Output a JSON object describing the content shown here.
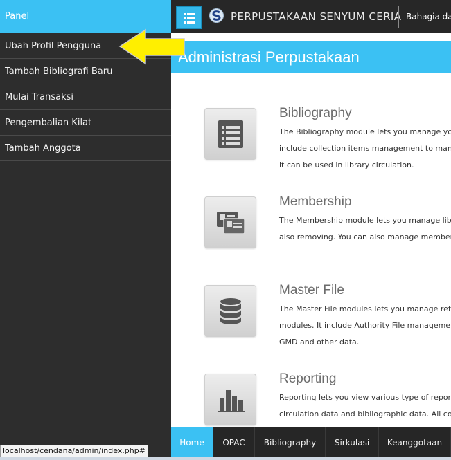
{
  "sidebar": {
    "header": "Panel",
    "items": [
      {
        "label": "Ubah Profil Pengguna"
      },
      {
        "label": "Tambah Bibliografi Baru"
      },
      {
        "label": "Mulai Transaksi"
      },
      {
        "label": "Pengembalian Kilat"
      },
      {
        "label": "Tambah Anggota"
      }
    ]
  },
  "topbar": {
    "menu_icon": "hamburger-list-icon",
    "logo_icon": "senayan-logo-icon",
    "brand": "PERPUSTAKAAN SENYUM CERIA",
    "greeting": "Bahagia dari"
  },
  "page": {
    "title": "Administrasi Perpustakaan"
  },
  "modules": [
    {
      "title": "Bibliography",
      "icon": "list-document-icon",
      "lines": [
        "The Bibliography module lets you manage your library bibliographical data. It",
        "include collection items management to manage a copies of your library so",
        "it can be used in library circulation."
      ]
    },
    {
      "title": "Membership",
      "icon": "member-cards-icon",
      "lines": [
        "The Membership module lets you manage library members such adding, updating and",
        "also removing. You can also manage membership type in this module."
      ]
    },
    {
      "title": "Master File",
      "icon": "database-icon",
      "lines": [
        "The Master File modules lets you manage referential data that will be used by another",
        "modules. It include Authority File management such as Authority, Subject/Topic List,",
        "GMD and other data."
      ]
    },
    {
      "title": "Reporting",
      "icon": "bar-chart-icon",
      "lines": [
        "Reporting lets you view various type of reports regardings membership data,",
        "circulation data and bibliographic data. All compiled on-the-fly from current library"
      ]
    }
  ],
  "bottomnav": {
    "items": [
      {
        "label": "Home",
        "active": true
      },
      {
        "label": "OPAC"
      },
      {
        "label": "Bibliography"
      },
      {
        "label": "Sirkulasi"
      },
      {
        "label": "Keanggotaan"
      }
    ]
  },
  "status": {
    "url": "localhost/cendana/admin/index.php#"
  },
  "colors": {
    "accent": "#3bc1f3",
    "sidebar_bg": "#2d2d2d",
    "arrow": "#ffef00"
  }
}
